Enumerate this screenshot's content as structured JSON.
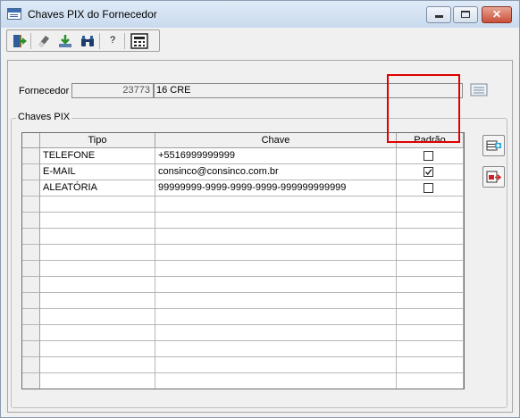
{
  "window": {
    "title": "Chaves PIX do Fornecedor",
    "close_glyph": "✕"
  },
  "toolbar": {
    "buttons": [
      {
        "name": "exit-icon"
      },
      {
        "name": "eraser-icon"
      },
      {
        "name": "download-icon"
      },
      {
        "name": "binoculars-icon"
      },
      {
        "name": "help-icon",
        "label": "?"
      },
      {
        "name": "calculator-icon"
      }
    ]
  },
  "fornecedor": {
    "label": "Fornecedor",
    "code": "23773",
    "name": "16 CRE"
  },
  "chaves_pix": {
    "group_title": "Chaves PIX",
    "columns": [
      "Tipo",
      "Chave",
      "Padrão"
    ],
    "rows": [
      {
        "tipo": "TELEFONE",
        "chave": "+5516999999999",
        "padrao": false
      },
      {
        "tipo": "E-MAIL",
        "chave": "consinco@consinco.com.br",
        "padrao": true
      },
      {
        "tipo": "ALEATÓRIA",
        "chave": "99999999-9999-9999-9999-999999999999",
        "padrao": false
      }
    ],
    "empty_rows": 12
  },
  "colors": {
    "highlight": "#e00000",
    "close_button": "#c9503a"
  }
}
